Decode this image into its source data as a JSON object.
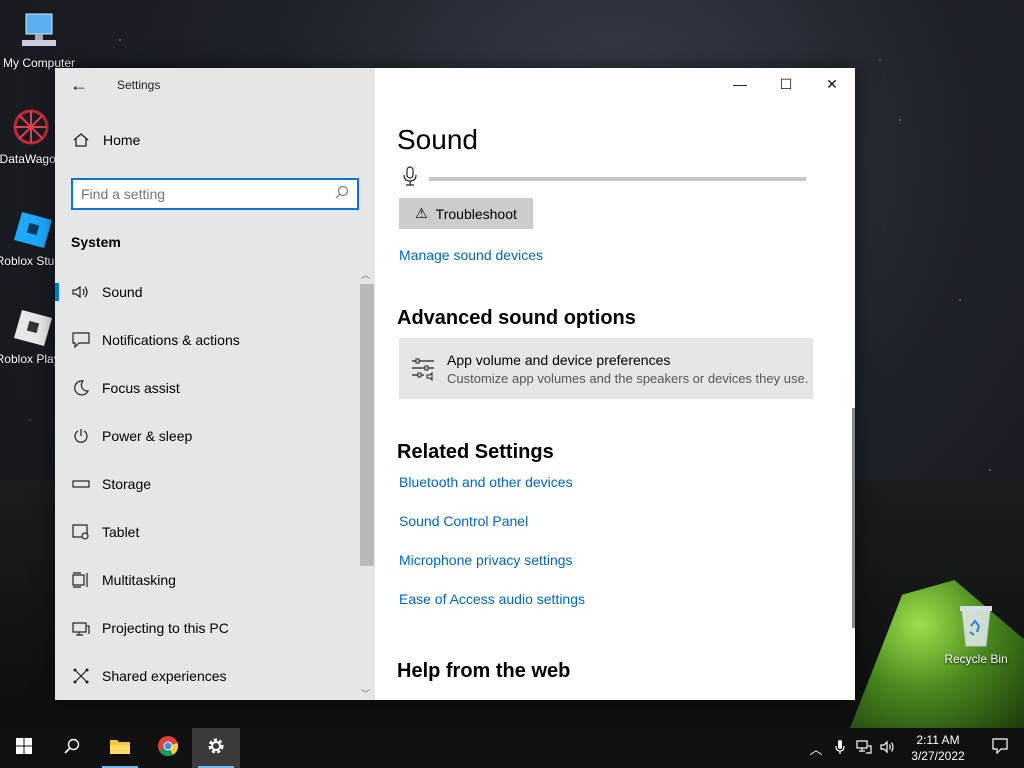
{
  "desktop": {
    "icons": [
      {
        "label": "My Computer"
      },
      {
        "label": "DataWagon"
      },
      {
        "label": "Roblox Studio"
      },
      {
        "label": "Roblox Player"
      }
    ],
    "recycle_bin": {
      "label": "Recycle Bin"
    }
  },
  "window": {
    "title": "Settings",
    "controls": {
      "minimize": "—",
      "maximize": "☐",
      "close": "✕"
    }
  },
  "nav": {
    "home_label": "Home",
    "search_placeholder": "Find a setting",
    "section_title": "System",
    "items": [
      {
        "label": "Sound",
        "icon": "speaker-icon",
        "active": true
      },
      {
        "label": "Notifications & actions",
        "icon": "notification-icon"
      },
      {
        "label": "Focus assist",
        "icon": "moon-icon"
      },
      {
        "label": "Power & sleep",
        "icon": "power-icon"
      },
      {
        "label": "Storage",
        "icon": "storage-icon"
      },
      {
        "label": "Tablet",
        "icon": "tablet-icon"
      },
      {
        "label": "Multitasking",
        "icon": "multitasking-icon"
      },
      {
        "label": "Projecting to this PC",
        "icon": "projecting-icon"
      },
      {
        "label": "Shared experiences",
        "icon": "shared-icon"
      }
    ]
  },
  "content": {
    "title": "Sound",
    "troubleshoot_label": "Troubleshoot",
    "manage_devices_link": "Manage sound devices",
    "advanced_heading": "Advanced sound options",
    "app_volume": {
      "title": "App volume and device preferences",
      "subtitle": "Customize app volumes and the speakers or devices they use."
    },
    "related_heading": "Related Settings",
    "related_links": [
      "Bluetooth and other devices",
      "Sound Control Panel",
      "Microphone privacy settings",
      "Ease of Access audio settings"
    ],
    "help_heading": "Help from the web"
  },
  "taskbar": {
    "clock_time": "2:11 AM",
    "clock_date": "3/27/2022"
  },
  "colors": {
    "accent": "#0078d4",
    "link": "#0067b8",
    "nav_bg": "#e6e6e6",
    "taskbar_bg": "#101010"
  }
}
